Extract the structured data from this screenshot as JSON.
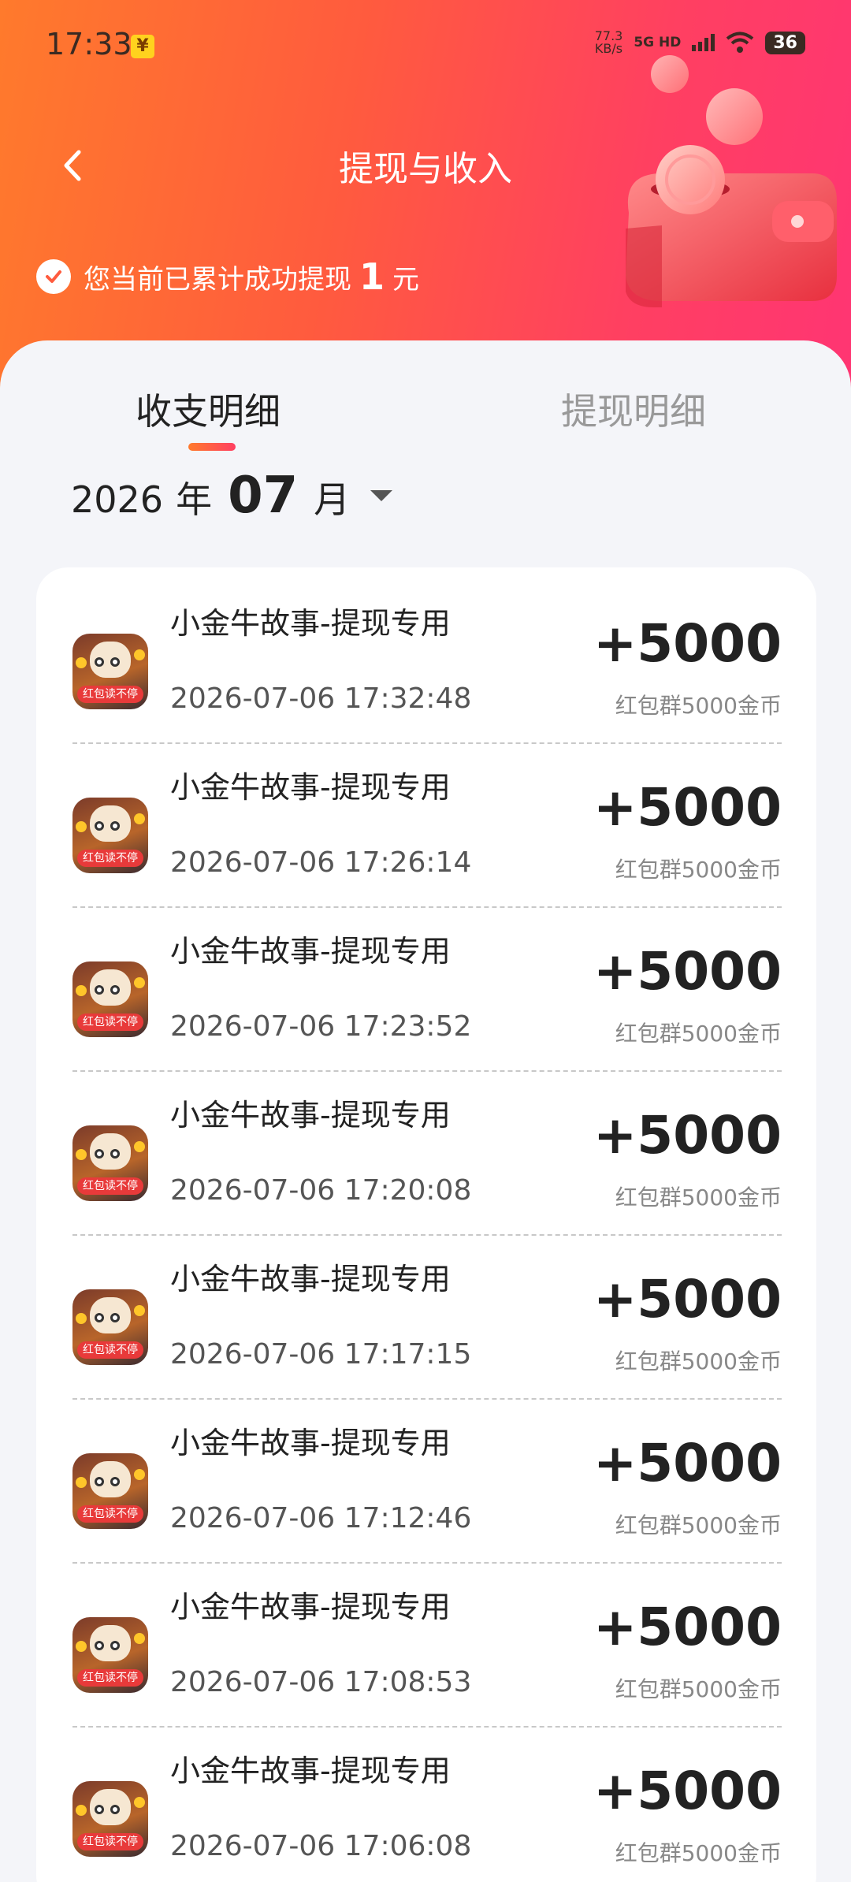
{
  "status_bar": {
    "time": "17:33",
    "pay_icon": "yuan-badge-icon",
    "net_speed": "77.3",
    "net_unit": "KB/s",
    "net_type": "5G HD",
    "battery": "36"
  },
  "header": {
    "title": "提现与收入",
    "note_prefix": "您当前已累计成功提现",
    "note_amount": "1",
    "note_suffix": "元"
  },
  "tabs": [
    {
      "label": "收支明细",
      "active": true
    },
    {
      "label": "提现明细",
      "active": false
    }
  ],
  "month_picker": {
    "year": "2026",
    "year_unit": "年",
    "month": "07",
    "month_unit": "月"
  },
  "records": [
    {
      "title": "小金牛故事-提现专用",
      "time": "2026-07-06 17:32:48",
      "amount": "+5000",
      "note": "红包群5000金币"
    },
    {
      "title": "小金牛故事-提现专用",
      "time": "2026-07-06 17:26:14",
      "amount": "+5000",
      "note": "红包群5000金币"
    },
    {
      "title": "小金牛故事-提现专用",
      "time": "2026-07-06 17:23:52",
      "amount": "+5000",
      "note": "红包群5000金币"
    },
    {
      "title": "小金牛故事-提现专用",
      "time": "2026-07-06 17:20:08",
      "amount": "+5000",
      "note": "红包群5000金币"
    },
    {
      "title": "小金牛故事-提现专用",
      "time": "2026-07-06 17:17:15",
      "amount": "+5000",
      "note": "红包群5000金币"
    },
    {
      "title": "小金牛故事-提现专用",
      "time": "2026-07-06 17:12:46",
      "amount": "+5000",
      "note": "红包群5000金币"
    },
    {
      "title": "小金牛故事-提现专用",
      "time": "2026-07-06 17:08:53",
      "amount": "+5000",
      "note": "红包群5000金币"
    },
    {
      "title": "小金牛故事-提现专用",
      "time": "2026-07-06 17:06:08",
      "amount": "+5000",
      "note": "红包群5000金币"
    }
  ],
  "app_icon_badge": "红包读不停",
  "colors": {
    "header_start": "#ff7a2c",
    "header_end": "#ff3573",
    "accent": "#ff5b3e"
  }
}
